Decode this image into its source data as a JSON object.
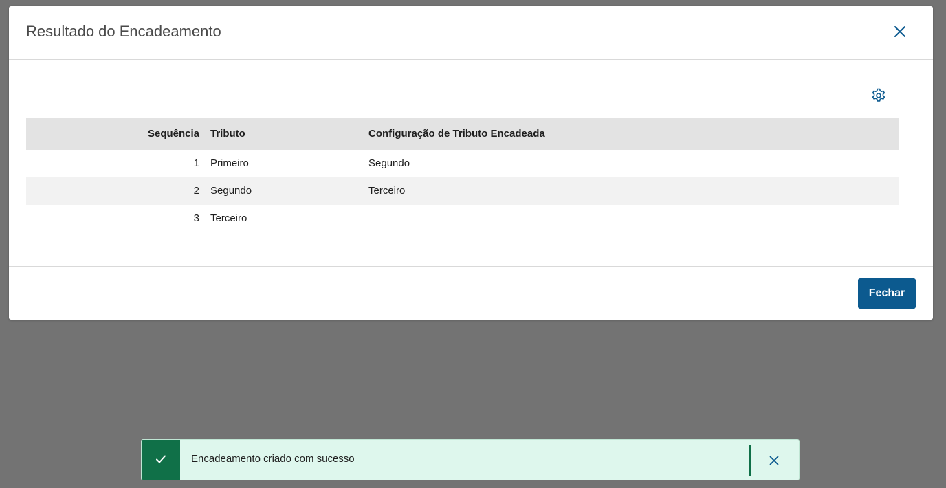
{
  "modal": {
    "title": "Resultado do Encadeamento",
    "close_icon": "close-icon",
    "settings_icon": "gear-icon"
  },
  "table": {
    "headers": {
      "sequence": "Sequência",
      "tributo": "Tributo",
      "config": "Configuração de Tributo Encadeada"
    },
    "rows": [
      {
        "sequence": "1",
        "tributo": "Primeiro",
        "config": "Segundo"
      },
      {
        "sequence": "2",
        "tributo": "Segundo",
        "config": "Terceiro"
      },
      {
        "sequence": "3",
        "tributo": "Terceiro",
        "config": ""
      }
    ]
  },
  "footer": {
    "close_label": "Fechar"
  },
  "toast": {
    "message": "Encadeamento criado com sucesso",
    "status_icon": "check-icon",
    "close_icon": "close-icon"
  },
  "colors": {
    "primary": "#0c5a8f",
    "success": "#107048",
    "success_bg": "#def7ed",
    "backdrop": "#737373",
    "header_bg": "#e3e3e3",
    "row_alt_bg": "#f2f2f2"
  }
}
